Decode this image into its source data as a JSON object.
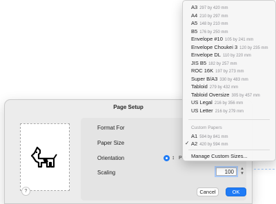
{
  "dialog": {
    "title": "Page Setup",
    "format_for_label": "Format For",
    "paper_size_label": "Paper Size",
    "orientation_label": "Orientation",
    "orientation_portrait": "Por",
    "scaling_label": "Scaling",
    "scaling_value": "100",
    "help_label": "?",
    "cancel_label": "Cancel",
    "ok_label": "OK"
  },
  "paper_menu": {
    "items": [
      {
        "name": "A3",
        "size": "297 by 420 mm"
      },
      {
        "name": "A4",
        "size": "210 by 297 mm"
      },
      {
        "name": "A5",
        "size": "148 by 210 mm"
      },
      {
        "name": "B5",
        "size": "176 by 250 mm"
      },
      {
        "name": "Envelope #10",
        "size": "105 by 241 mm"
      },
      {
        "name": "Envelope Choukei 3",
        "size": "120 by 235 mm"
      },
      {
        "name": "Envelope DL",
        "size": "110 by 220 mm"
      },
      {
        "name": "JIS B5",
        "size": "182 by 257 mm"
      },
      {
        "name": "ROC 16K",
        "size": "197 by 273 mm"
      },
      {
        "name": "Super B/A3",
        "size": "330 by 483 mm"
      },
      {
        "name": "Tabloid",
        "size": "279 by 432 mm"
      },
      {
        "name": "Tabloid Oversize",
        "size": "305 by 457 mm"
      },
      {
        "name": "US Legal",
        "size": "216 by 356 mm"
      },
      {
        "name": "US Letter",
        "size": "216 by 279 mm"
      }
    ],
    "custom_header": "Custom Papers",
    "custom_items": [
      {
        "name": "A1",
        "size": "594 by 841 mm",
        "checked": false
      },
      {
        "name": "A2",
        "size": "420 by 594 mm",
        "checked": true
      }
    ],
    "manage_label": "Manage Custom Sizes..."
  },
  "colors": {
    "accent": "#1f7bf6"
  }
}
